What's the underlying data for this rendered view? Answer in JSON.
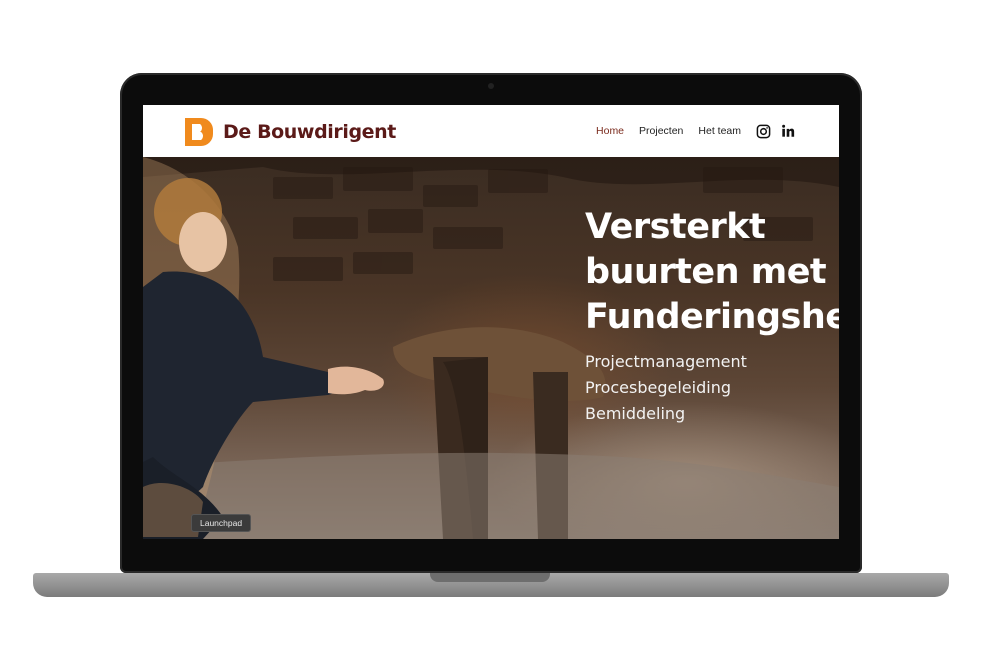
{
  "site": {
    "brand": "De Bouwdirigent",
    "brand_colors": {
      "mark": "#f08a1d",
      "text": "#5b1a18"
    },
    "nav": [
      {
        "label": "Home",
        "active": true
      },
      {
        "label": "Projecten",
        "active": false
      },
      {
        "label": "Het team",
        "active": false
      }
    ],
    "social": [
      {
        "icon": "instagram-icon"
      },
      {
        "icon": "linkedin-icon"
      }
    ]
  },
  "hero": {
    "title": "Versterkt\nbuurten met\nFunderingsher",
    "services": [
      "Projectmanagement",
      "Procesbegeleiding",
      "Bemiddeling"
    ]
  },
  "tooltip": {
    "label": "Launchpad"
  }
}
